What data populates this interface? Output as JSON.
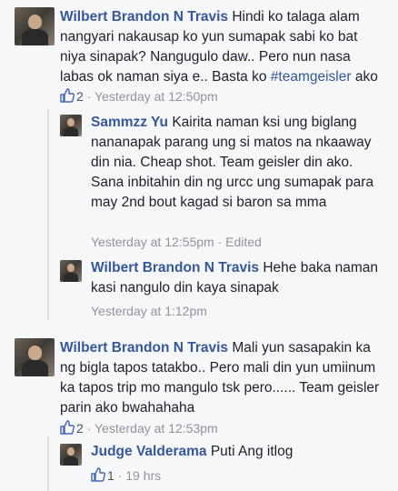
{
  "comments": [
    {
      "author": "Wilbert Brandon N Travis",
      "text_before": "Hindi ko talaga alam nangyari nakausap ko yun sumapak sabi ko bat niya sinapak? Nangugulo daw.. Pero nun nasa labas ok naman siya e.. Basta ko ",
      "hashtag": "#teamgeisler",
      "text_after": " ako",
      "likes": "2",
      "time": "Yesterday at 12:50pm",
      "replies": [
        {
          "author": "Sammzz Yu",
          "text": "Kairita naman ksi ung biglang nananapak parang ung si matos na nkaaway din nia. Cheap shot. Team geisler din ako. Sana inbitahin din ng urcc ung sumapak para may 2nd bout kagad si baron sa mma",
          "time": "Yesterday at 12:55pm",
          "edited": "Edited"
        },
        {
          "author": "Wilbert Brandon N Travis",
          "text": "Hehe baka naman kasi nangulo din kaya sinapak",
          "time": "Yesterday at 1:12pm"
        }
      ]
    },
    {
      "author": "Wilbert Brandon N Travis",
      "text": "Mali yun sasapakin ka ng bigla tapos tatakbo.. Pero mali din yun umiinum ka tapos trip mo mangulo tsk pero...... Team geisler parin ako bwahahaha",
      "likes": "2",
      "time": "Yesterday at 12:53pm",
      "replies": [
        {
          "author": "Judge Valderama",
          "text": "Puti Ang itlog",
          "likes": "1",
          "time": "19 hrs"
        }
      ]
    }
  ],
  "separator": "·",
  "colors": {
    "link": "#365899",
    "meta": "#90949c",
    "background": "#f6f7f9"
  },
  "icons": {
    "like": "thumbs-up-icon",
    "avatar": "profile-photo"
  }
}
